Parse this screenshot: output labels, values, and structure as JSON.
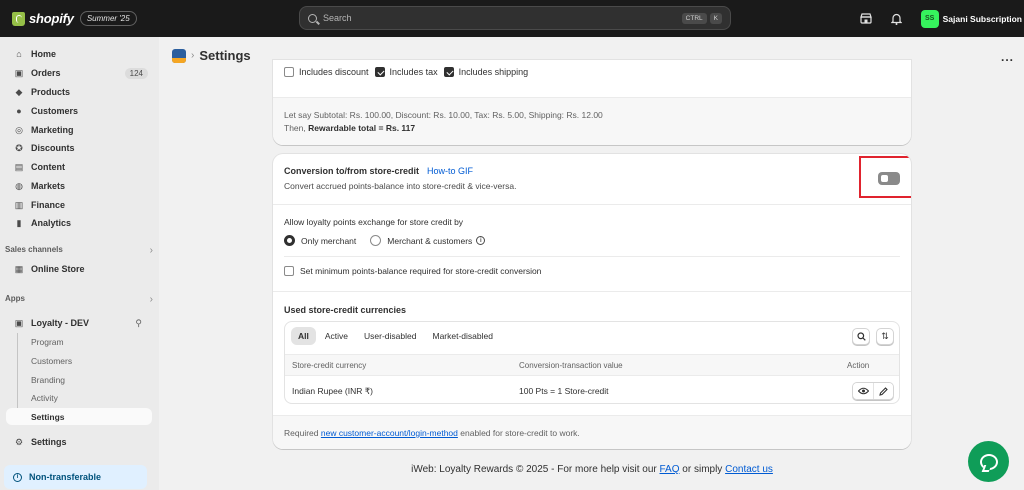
{
  "topbar": {
    "brand": "shopify",
    "edition": "Summer '25",
    "search_placeholder": "Search",
    "shortcut_keys": [
      "CTRL",
      "K"
    ],
    "store_initials": "SS",
    "store_name": "Sajani Subscription",
    "icons": [
      "store-icon",
      "bell-icon"
    ]
  },
  "sidebar": {
    "items": [
      {
        "label": "Home",
        "icon": "home-icon"
      },
      {
        "label": "Orders",
        "icon": "orders-icon",
        "badge": "124"
      },
      {
        "label": "Products",
        "icon": "tag-icon"
      },
      {
        "label": "Customers",
        "icon": "person-icon"
      },
      {
        "label": "Marketing",
        "icon": "target-icon"
      },
      {
        "label": "Discounts",
        "icon": "discount-icon"
      },
      {
        "label": "Content",
        "icon": "content-icon"
      },
      {
        "label": "Markets",
        "icon": "globe-icon"
      },
      {
        "label": "Finance",
        "icon": "bank-icon"
      },
      {
        "label": "Analytics",
        "icon": "chart-icon"
      }
    ],
    "sales_channels": {
      "title": "Sales channels",
      "items": [
        {
          "label": "Online Store",
          "icon": "store-icon"
        }
      ]
    },
    "apps": {
      "title": "Apps",
      "app": {
        "label": "Loyalty - DEV",
        "icon": "app-icon"
      },
      "sub_items": [
        "Program",
        "Customers",
        "Branding",
        "Activity",
        "Settings"
      ]
    },
    "settings_label": "Settings",
    "non_transferable": "Non-transferable"
  },
  "page": {
    "title": "Settings",
    "more": "..."
  },
  "card1": {
    "checkboxes": [
      {
        "label": "Includes discount",
        "checked": false
      },
      {
        "label": "Includes tax",
        "checked": true
      },
      {
        "label": "Includes shipping",
        "checked": true
      }
    ],
    "example_line": "Let say Subtotal: Rs. 100.00, Discount: Rs. 10.00, Tax: Rs. 5.00, Shipping: Rs. 12.00",
    "then_prefix": "Then,",
    "result": "Rewardable total = Rs. 117"
  },
  "card2": {
    "title": "Conversion to/from store-credit",
    "howto": "How-to GIF",
    "desc": "Convert accrued points-balance into store-credit & vice-versa.",
    "toggle_on": false,
    "allow_title": "Allow loyalty points exchange for store credit by",
    "radios": [
      {
        "label": "Only merchant",
        "checked": true
      },
      {
        "label": "Merchant & customers",
        "checked": false
      }
    ],
    "min_balance_label": "Set minimum points-balance required for store-credit conversion",
    "used_title": "Used store-credit currencies",
    "tabs": [
      "All",
      "Active",
      "User-disabled",
      "Market-disabled"
    ],
    "columns": [
      "Store-credit currency",
      "Conversion-transaction value",
      "Action"
    ],
    "rows": [
      {
        "currency": "Indian Rupee (INR ₹)",
        "value": "100 Pts = 1 Store-credit"
      }
    ],
    "foot_prefix": "Required",
    "foot_link": "new customer-account/login-method",
    "foot_suffix": "enabled for store-credit to work."
  },
  "footer": {
    "prefix": "iWeb: Loyalty Rewards © 2025 - For more help visit our",
    "faq": "FAQ",
    "middle": "or simply",
    "contact": "Contact us"
  }
}
